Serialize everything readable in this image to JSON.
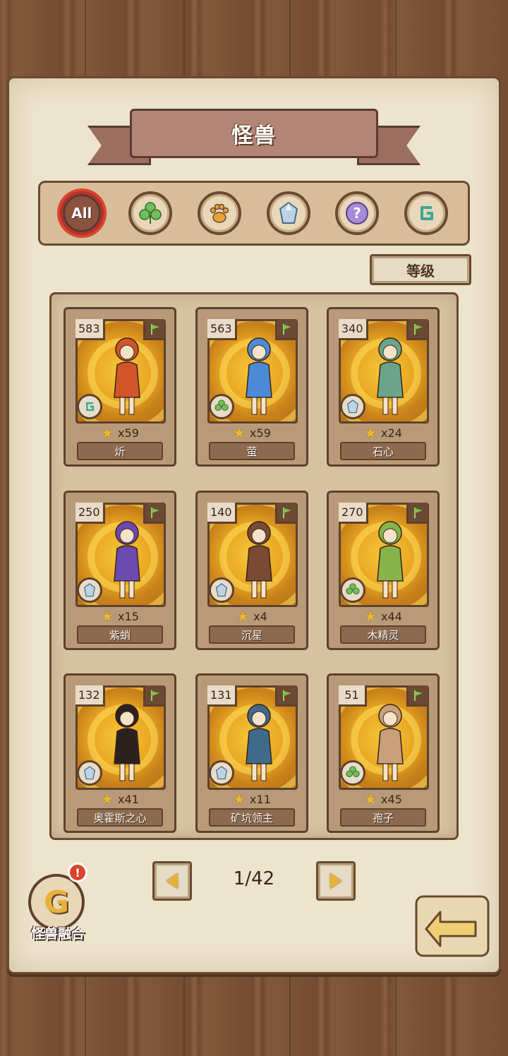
{
  "header": {
    "title": "怪兽"
  },
  "filters": [
    {
      "id": "all",
      "label": "All",
      "icon": "all-icon",
      "active": true
    },
    {
      "id": "plant",
      "label": "",
      "icon": "clover-icon",
      "active": false
    },
    {
      "id": "beast",
      "label": "",
      "icon": "paw-icon",
      "active": false
    },
    {
      "id": "mineral",
      "label": "",
      "icon": "crystal-icon",
      "active": false
    },
    {
      "id": "mystery",
      "label": "",
      "icon": "question-icon",
      "active": false
    },
    {
      "id": "special",
      "label": "",
      "icon": "g-rune-icon",
      "active": false
    }
  ],
  "sort": {
    "label": "等级"
  },
  "cards": [
    {
      "level": "583",
      "count": "x59",
      "name": "炘",
      "type_icon": "g-rune-icon",
      "color": "#d2552a"
    },
    {
      "level": "563",
      "count": "x59",
      "name": "萤",
      "type_icon": "clover-icon",
      "color": "#4c8ad6"
    },
    {
      "level": "340",
      "count": "x24",
      "name": "石心",
      "type_icon": "crystal-icon",
      "color": "#6aa58a"
    },
    {
      "level": "250",
      "count": "x15",
      "name": "紫蛸",
      "type_icon": "crystal-icon",
      "color": "#6b4ab0"
    },
    {
      "level": "140",
      "count": "x4",
      "name": "沉星",
      "type_icon": "crystal-icon",
      "color": "#7a4a34"
    },
    {
      "level": "270",
      "count": "x44",
      "name": "木精灵",
      "type_icon": "clover-icon",
      "color": "#86b44a"
    },
    {
      "level": "132",
      "count": "x41",
      "name": "奥霍斯之心",
      "type_icon": "crystal-icon",
      "color": "#2b2220"
    },
    {
      "level": "131",
      "count": "x11",
      "name": "矿坑领主",
      "type_icon": "crystal-icon",
      "color": "#3f6a8a"
    },
    {
      "level": "51",
      "count": "x45",
      "name": "孢子",
      "type_icon": "clover-icon",
      "color": "#c9a07a"
    }
  ],
  "pagination": {
    "label": "1/42"
  },
  "fusion": {
    "label": "怪兽融合",
    "alert": "!"
  },
  "colors": {
    "accent": "#d9452c",
    "gold": "#e6b336",
    "wood": "#6a4a30"
  }
}
